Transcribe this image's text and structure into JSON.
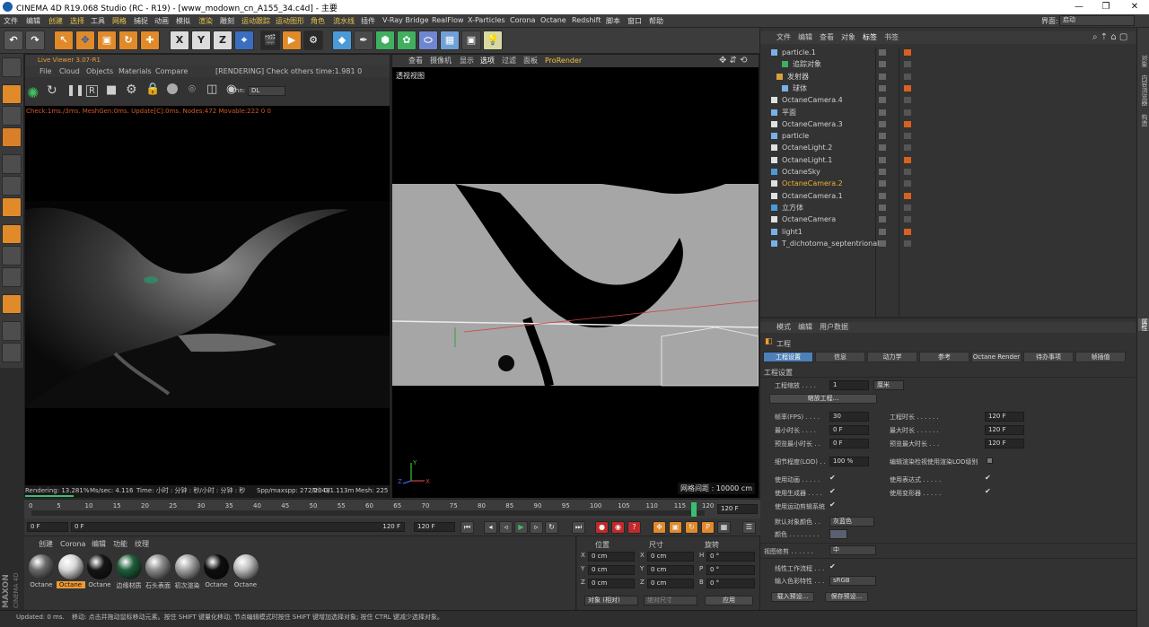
{
  "window": {
    "title": "CINEMA 4D R19.068 Studio (RC - R19) - [www_modown_cn_A155_34.c4d] - 主要",
    "min": "—",
    "max": "❐",
    "close": "✕"
  },
  "menubar": {
    "items": [
      "文件",
      "编辑",
      "创建",
      "选择",
      "工具",
      "网格",
      "捕捉",
      "动画",
      "模拟",
      "渲染",
      "雕刻",
      "运动跟踪",
      "运动图形",
      "角色",
      "流水线",
      "插件",
      "V-Ray Bridge",
      "RealFlow",
      "X-Particles",
      "Corona",
      "Octane",
      "Redshift",
      "脚本",
      "窗口",
      "帮助"
    ],
    "layout_label": "界面:",
    "layout_value": "启动"
  },
  "liveviewer": {
    "title": "Live Viewer 3.07-R1",
    "menu": [
      "File",
      "Cloud",
      "Objects",
      "Materials",
      "Compare"
    ],
    "rendering_msg": "[RENDERING] Check others time:1.981  0",
    "chn_label": "Chn:",
    "chn_value": "DL",
    "status_line": "Check:1ms./3ms. MeshGen:0ms. Update[C]:0ms. Nodes:472 Movable:222  0 0",
    "progress_pct": 13.281,
    "progress_text": "Rendering: 13.281%",
    "ms_sec": "Ms/sec: 4.116",
    "time": "Time: 小时 : 分钟 : 秒/小时 : 分钟 : 秒",
    "spp": "Spp/maxspp: 272/2048",
    "tri": "Tri: 0/1.113m",
    "mesh": "Mesh: 225 I"
  },
  "viewport": {
    "menu": [
      "查看",
      "摄像机",
      "显示",
      "选项",
      "过滤",
      "面板",
      "ProRender"
    ],
    "label": "透视视图",
    "grid": "网格间距 : 10000 cm"
  },
  "objectmanager": {
    "menu": [
      "文件",
      "编辑",
      "查看",
      "对象",
      "标签",
      "书签"
    ],
    "objects": [
      {
        "name": "particle.1",
        "indent": 0
      },
      {
        "name": "追踪对象",
        "indent": 2
      },
      {
        "name": "发射器",
        "indent": 1
      },
      {
        "name": "球体",
        "indent": 2
      },
      {
        "name": "OctaneCamera.4",
        "indent": 0
      },
      {
        "name": "平面",
        "indent": 0
      },
      {
        "name": "OctaneCamera.3",
        "indent": 0
      },
      {
        "name": "particle",
        "indent": 0
      },
      {
        "name": "OctaneLight.2",
        "indent": 0
      },
      {
        "name": "OctaneLight.1",
        "indent": 0
      },
      {
        "name": "OctaneSky",
        "indent": 0
      },
      {
        "name": "OctaneCamera.2",
        "indent": 0,
        "selected": true
      },
      {
        "name": "OctaneCamera.1",
        "indent": 0
      },
      {
        "name": "立方体",
        "indent": 0
      },
      {
        "name": "OctaneCamera",
        "indent": 0
      },
      {
        "name": "light1",
        "indent": 0
      },
      {
        "name": "T_dichotoma_septentrionalis",
        "indent": 0
      }
    ]
  },
  "righttabs": [
    "对象",
    "内容浏览器",
    "构造",
    "属性"
  ],
  "attributes": {
    "menu": [
      "模式",
      "编辑",
      "用户数据"
    ],
    "header": "工程",
    "tabs": [
      "工程设置",
      "信息",
      "动力学",
      "参考",
      "Octane Render",
      "待办事项",
      "帧插值"
    ],
    "section": "工程设置",
    "scale_label": "工程缩放 . . . .",
    "scale_value": "1",
    "scale_unit": "厘米",
    "scale_btn": "缩放工程...",
    "fps_label": "帧率(FPS) . . . .",
    "fps_value": "30",
    "proj_time_label": "工程时长 . . . . . .",
    "proj_time_value": "120 F",
    "min_time_label": "最小时长 . . . .",
    "min_time_value": "0 F",
    "max_time_label": "最大时长 . . . . . .",
    "max_time_value": "120 F",
    "prev_min_label": "预览最小时长 . .",
    "prev_min_value": "0 F",
    "prev_max_label": "预览最大时长 . . .",
    "prev_max_value": "120 F",
    "lod_label": "细节程度(LOD) . .",
    "lod_value": "100 %",
    "lod_render_label": "编辑渲染检视使用渲染LOD级别",
    "use_anim": "使用动画 . . . . .",
    "use_expr": "使用表达式 . . . . .",
    "use_gen": "使用生成器 . . . .",
    "use_deform": "使用变形器 . . . . .",
    "use_motion": "使用运动剪辑系统",
    "def_color_label": "默认对象颜色 . .",
    "def_color_value": "灰蓝色",
    "color_label": "颜色 . . . . . . . .",
    "view_clip_label": "视图修剪 . . . . . .",
    "view_clip_value": "中",
    "linear_label": "线性工作流程 . . .",
    "input_color_label": "输入色彩特性 . . .",
    "input_color_value": "sRGB",
    "load_preset": "载入预设...",
    "save_preset": "保存预设...",
    "check": "✔"
  },
  "timeline": {
    "ticks": [
      "0",
      "5",
      "10",
      "15",
      "20",
      "25",
      "30",
      "35",
      "40",
      "45",
      "50",
      "55",
      "60",
      "65",
      "70",
      "75",
      "80",
      "85",
      "90",
      "95",
      "100",
      "105",
      "110",
      "115",
      "120"
    ],
    "end_field": "120 F",
    "current_frame": 118
  },
  "transport": {
    "start": "0 F",
    "current": "0 F",
    "end_a": "120 F",
    "end_b": "120 F"
  },
  "materials": {
    "menu": [
      "创建",
      "Corona",
      "编辑",
      "功能",
      "纹理"
    ],
    "items": [
      {
        "label": "Octane",
        "color": "#6a6a6a",
        "selected": false
      },
      {
        "label": "Octane",
        "color": "#d8d8d8",
        "selected": true
      },
      {
        "label": "Octane",
        "color": "#151515",
        "selected": false
      },
      {
        "label": "边缘材质",
        "color": "#1f5e3a",
        "selected": false
      },
      {
        "label": "石头表面",
        "color": "#8c8c8c",
        "selected": false
      },
      {
        "label": "初次渲染",
        "color": "#a4a4a4",
        "selected": false
      },
      {
        "label": "Octane",
        "color": "#0e0e0e",
        "selected": false
      },
      {
        "label": "Octane",
        "color": "#bdbdbd",
        "selected": false
      }
    ]
  },
  "coords": {
    "headers": [
      "位置",
      "尺寸",
      "旋转"
    ],
    "rows": [
      {
        "axis": "X",
        "pos": "0 cm",
        "size_axis": "X",
        "size": "0 cm",
        "rot_axis": "H",
        "rot": "0 °"
      },
      {
        "axis": "Y",
        "pos": "0 cm",
        "size_axis": "Y",
        "size": "0 cm",
        "rot_axis": "P",
        "rot": "0 °"
      },
      {
        "axis": "Z",
        "pos": "0 cm",
        "size_axis": "Z",
        "size": "0 cm",
        "rot_axis": "B",
        "rot": "0 °"
      }
    ],
    "mode": "对象 (相对)",
    "size_mode": "绝对尺寸",
    "apply": "应用"
  },
  "status": {
    "updated": "Updated: 0 ms.",
    "hint": "移动: 点击并拖动鼠标移动元素。按住 SHIFT 键量化移动; 节点编辑模式时按住 SHIFT 键增加选择对象; 按住 CTRL 键减少选择对象。"
  },
  "brand": {
    "line1": "MAXON",
    "line2": "CINEMA 4D"
  },
  "colors": {
    "accent_blue": "#4d7fb8",
    "accent_orange": "#f09a33",
    "highlight_yellow": "#f0b030",
    "timeline_green": "#38c070"
  }
}
